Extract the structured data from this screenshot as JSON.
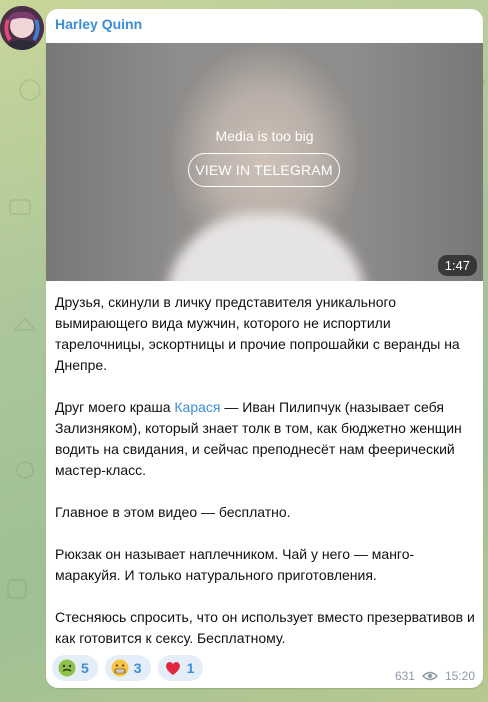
{
  "post": {
    "author": "Harley Quinn",
    "media": {
      "message": "Media is too big",
      "button_label": "VIEW IN TELEGRAM",
      "duration": "1:47"
    },
    "paragraphs": {
      "p1": "Друзья, скинули в личку представителя уникального вымирающего вида мужчин, которого не испортили тарелочницы, эскортницы и прочие попрошайки с веранды на Днепре.",
      "p2_before": "Друг моего краша ",
      "p2_link": "Карася",
      "p2_after": " — Иван Пилипчук (называет себя Зализняком), который знает толк в том, как бюджетно женщин водить на свидания, и сейчас преподнесёт нам феерический мастер-класс.",
      "p3": "Главное в этом видео — бесплатно.",
      "p4": "Рюкзак он называет наплечником. Чай у него — манго-маракуйя. И только натурального приготовления.",
      "p5": "Стесняюсь спросить, что он использует вместо презервативов и как готовится к сексу. Бесплатному."
    },
    "reactions": [
      {
        "emoji": "nauseated-face",
        "count": "5"
      },
      {
        "emoji": "grimacing-face",
        "count": "3"
      },
      {
        "emoji": "red-heart",
        "count": "1"
      }
    ],
    "views": "631",
    "time": "15:20"
  },
  "colors": {
    "accent": "#3a8ed6",
    "bubble": "#ffffff",
    "reaction_bg": "#e4eef8",
    "meta": "#8e9aa5"
  }
}
